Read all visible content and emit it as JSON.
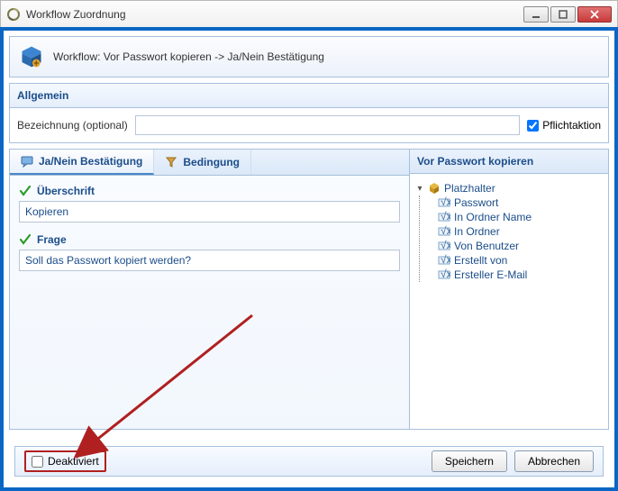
{
  "window": {
    "title": "Workflow Zuordnung"
  },
  "workflow_header": {
    "text": "Workflow: Vor Passwort kopieren -> Ja/Nein Bestätigung"
  },
  "allgemein": {
    "title": "Allgemein",
    "bezeichnung_label": "Bezeichnung (optional)",
    "bezeichnung_value": "",
    "pflicht_label": "Pflichtaktion",
    "pflicht_checked": true
  },
  "tabs": {
    "items": [
      {
        "label": "Ja/Nein Bestätigung",
        "active": true
      },
      {
        "label": "Bedingung",
        "active": false
      }
    ]
  },
  "form": {
    "ueberschrift_label": "Überschrift",
    "ueberschrift_value": "Kopieren",
    "frage_label": "Frage",
    "frage_value": "Soll das Passwort kopiert werden?"
  },
  "right": {
    "title": "Vor Passwort kopieren",
    "root": "Platzhalter",
    "items": [
      "Passwort",
      "In Ordner Name",
      "In Ordner",
      "Von Benutzer",
      "Erstellt von",
      "Ersteller E-Mail"
    ]
  },
  "footer": {
    "deaktiviert_label": "Deaktiviert",
    "speichern_label": "Speichern",
    "abbrechen_label": "Abbrechen"
  }
}
